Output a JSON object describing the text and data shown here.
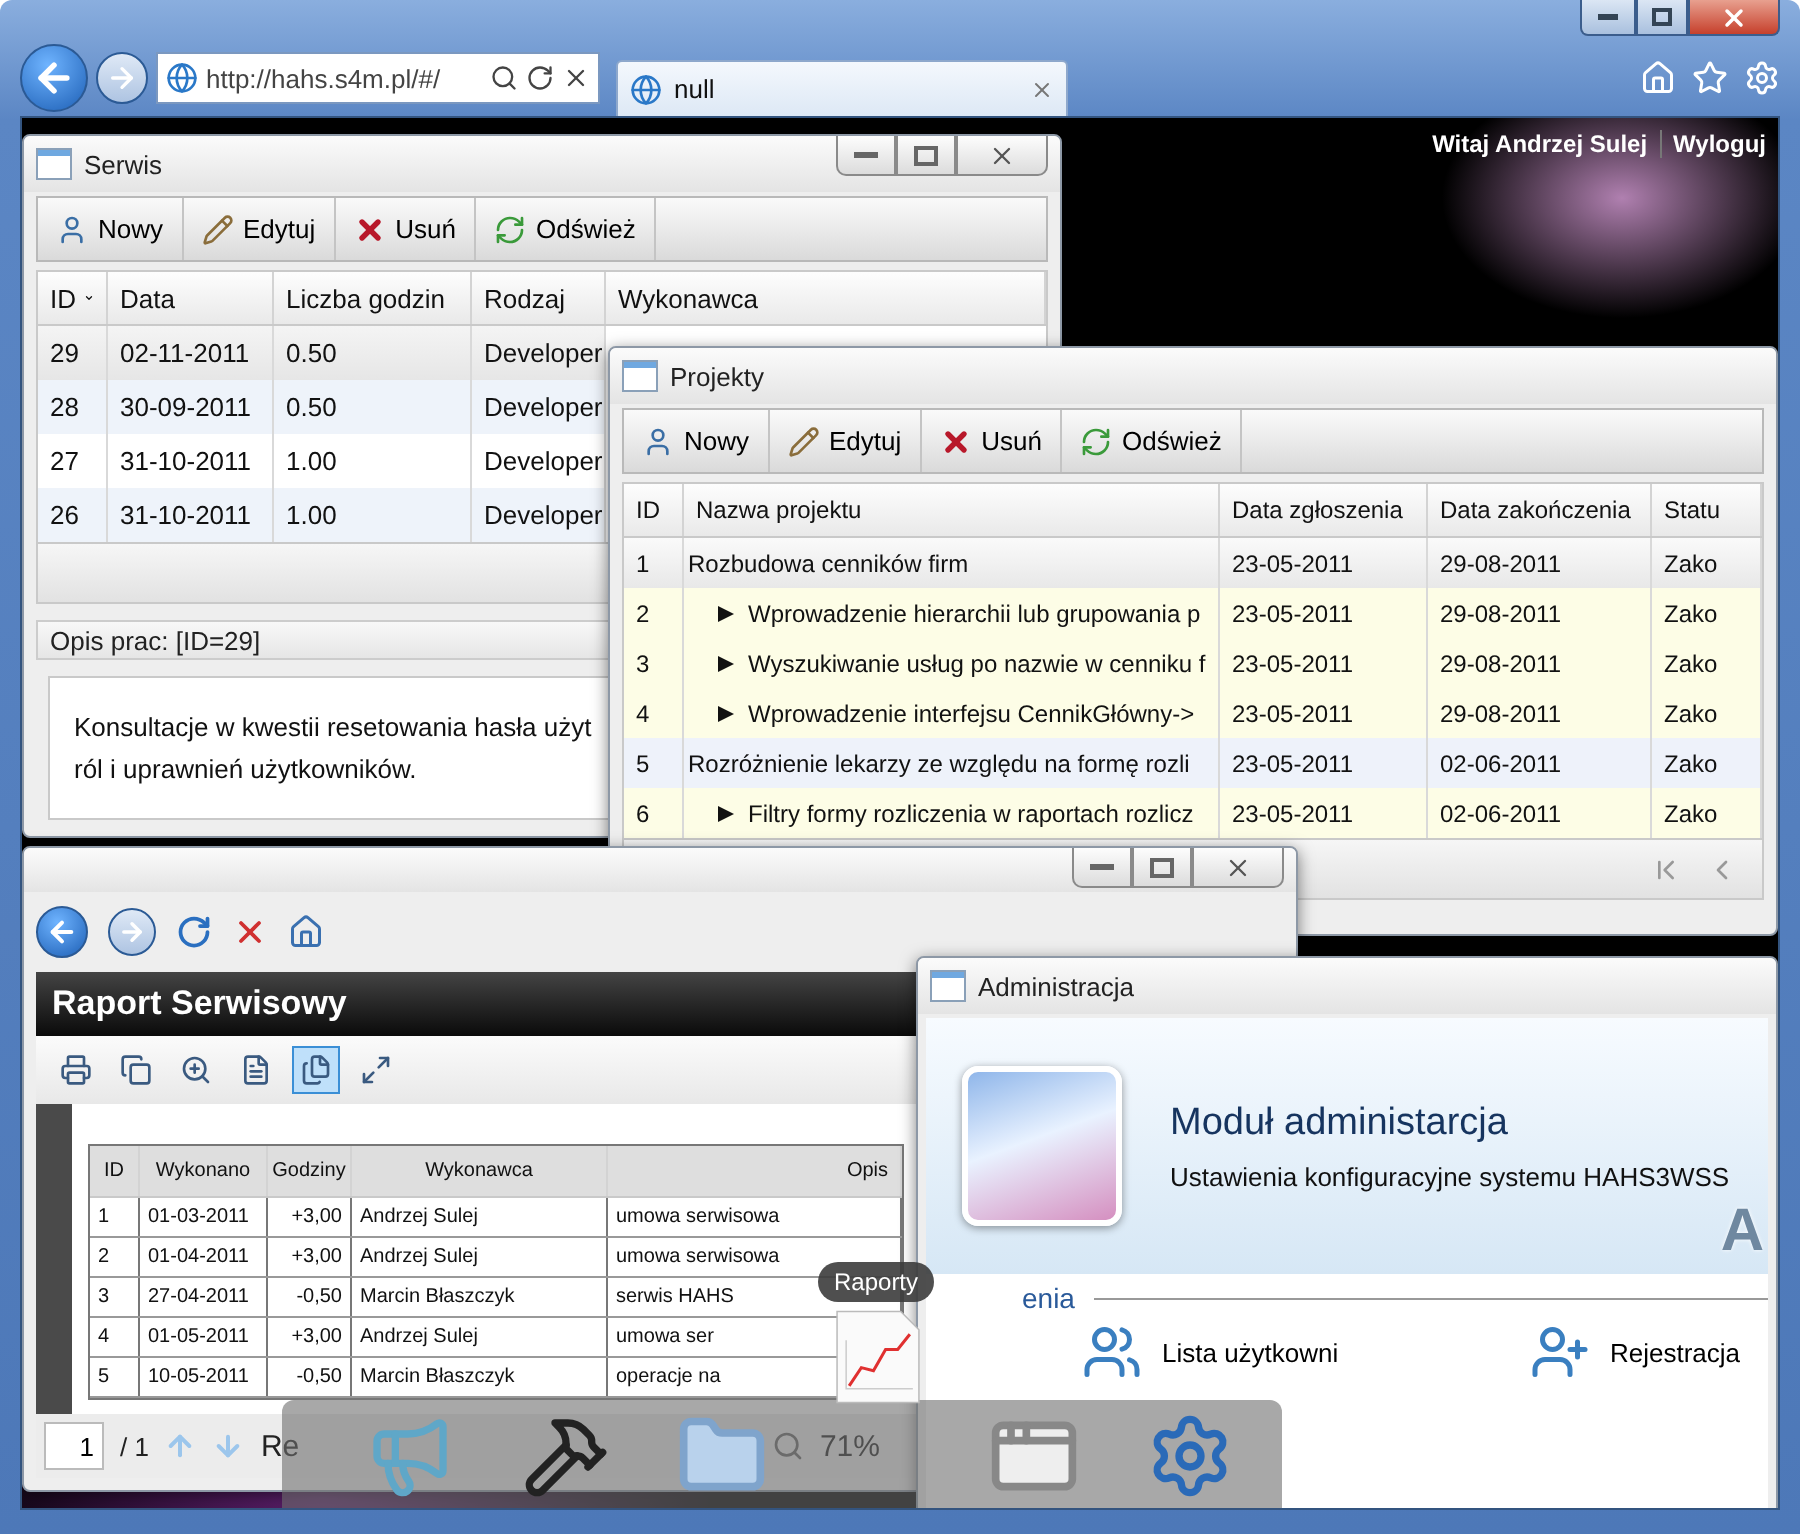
{
  "browser": {
    "address": "http://hahs.s4m.pl/#/",
    "tabs": [
      {
        "label": "null",
        "selected": true
      }
    ]
  },
  "header": {
    "greeting": "Witaj Andrzej Sulej",
    "logout": "Wyloguj"
  },
  "serwis": {
    "title": "Serwis",
    "has_controls": true,
    "toolbar": [
      {
        "kind": "new",
        "label": "Nowy"
      },
      {
        "kind": "edit",
        "label": "Edytuj"
      },
      {
        "kind": "delete",
        "label": "Usuń"
      },
      {
        "kind": "refresh",
        "label": "Odśwież"
      }
    ],
    "columns": [
      {
        "label": "ID",
        "sorted": true
      },
      {
        "label": "Data",
        "sorted": false
      },
      {
        "label": "Liczba godzin",
        "sorted": false
      },
      {
        "label": "Rodzaj",
        "sorted": false
      },
      {
        "label": "Wykonawca",
        "sorted": false
      }
    ],
    "rows": [
      {
        "cells": [
          "29",
          "02-11-2011",
          "0.50",
          "Developer"
        ],
        "selected": true
      },
      {
        "cells": [
          "28",
          "30-09-2011",
          "0.50",
          "Developer"
        ],
        "selected": false
      },
      {
        "cells": [
          "27",
          "31-10-2011",
          "1.00",
          "Developer"
        ],
        "selected": false
      },
      {
        "cells": [
          "26",
          "31-10-2011",
          "1.00",
          "Developer"
        ],
        "selected": false
      }
    ],
    "description_label": "Opis prac: [ID=29]",
    "description_lines": [
      "Konsultacje w kwestii resetowania hasła użyt",
      "ról i uprawnień użytkowników."
    ]
  },
  "projekty": {
    "title": "Projekty",
    "has_controls": false,
    "toolbar": [
      {
        "kind": "new",
        "label": "Nowy"
      },
      {
        "kind": "edit",
        "label": "Edytuj"
      },
      {
        "kind": "delete",
        "label": "Usuń"
      },
      {
        "kind": "refresh",
        "label": "Odśwież"
      }
    ],
    "columns": [
      "ID",
      "Nazwa projektu",
      "Data zgłoszenia",
      "Data zakończenia",
      "Statu"
    ],
    "rows": [
      {
        "id": "1",
        "name": "Rozbudowa cenników firm",
        "reported": "23-05-2011",
        "finished": "29-08-2011",
        "status": "Zako",
        "selected": true,
        "expanded": true,
        "children": [
          {
            "id": "2",
            "name": "Wprowadzenie hierarchii lub grupowania p",
            "reported": "23-05-2011",
            "finished": "29-08-2011",
            "status": "Zako",
            "selected": false,
            "expanded": false
          },
          {
            "id": "3",
            "name": "Wyszukiwanie usług po nazwie w cenniku f",
            "reported": "23-05-2011",
            "finished": "29-08-2011",
            "status": "Zako",
            "selected": false,
            "expanded": false
          },
          {
            "id": "4",
            "name": "Wprowadzenie interfejsu CennikGłówny->",
            "reported": "23-05-2011",
            "finished": "29-08-2011",
            "status": "Zako",
            "selected": false,
            "expanded": false
          }
        ]
      },
      {
        "id": "5",
        "name": "Rozróżnienie lekarzy ze względu na formę rozli",
        "reported": "23-05-2011",
        "finished": "02-06-2011",
        "status": "Zako",
        "selected": false,
        "expanded": true,
        "children": [
          {
            "id": "6",
            "name": "Filtry formy rozliczenia w raportach rozlicz",
            "reported": "23-05-2011",
            "finished": "02-06-2011",
            "status": "Zako",
            "selected": false,
            "expanded": false
          }
        ]
      }
    ]
  },
  "raport": {
    "has_controls": true,
    "title": "Raport Serwisowy",
    "tools": [
      {
        "kind": "print",
        "selected": false
      },
      {
        "kind": "copy",
        "selected": false
      },
      {
        "kind": "zoom",
        "selected": false
      },
      {
        "kind": "single",
        "selected": false
      },
      {
        "kind": "multi",
        "selected": true
      },
      {
        "kind": "fullscreen",
        "selected": false
      }
    ],
    "columns": [
      "ID",
      "Wykonano",
      "Godziny",
      "Wykonawca",
      "Opis"
    ],
    "rows": [
      [
        "1",
        "01-03-2011",
        "+3,00",
        "Andrzej Sulej",
        "umowa serwisowa"
      ],
      [
        "2",
        "01-04-2011",
        "+3,00",
        "Andrzej Sulej",
        "umowa serwisowa"
      ],
      [
        "3",
        "27-04-2011",
        "-0,50",
        "Marcin Błaszczyk",
        "serwis HAHS"
      ],
      [
        "4",
        "01-05-2011",
        "+3,00",
        "Andrzej Sulej",
        "umowa ser"
      ],
      [
        "5",
        "10-05-2011",
        "-0,50",
        "Marcin Błaszczyk",
        "operacje na"
      ]
    ],
    "page": "1",
    "page_total": "/ 1",
    "status_text": "Re",
    "zoom": "71%"
  },
  "admin": {
    "title": "Administracja",
    "heading": "Moduł administarcja",
    "subtitle": "Ustawienia konfiguracyjne systemu HAHS3WSS",
    "banner_letter": "A",
    "section": "enia",
    "items": [
      {
        "kind": "users",
        "label": "Lista użytkowni"
      },
      {
        "kind": "register",
        "label": "Rejestracja"
      }
    ]
  },
  "dock": {
    "tooltip": "Raporty",
    "items": [
      {
        "kind": "megaphone",
        "selected": false
      },
      {
        "kind": "hammer",
        "selected": false
      },
      {
        "kind": "folder",
        "selected": false
      },
      {
        "kind": "report",
        "selected": true
      },
      {
        "kind": "window",
        "selected": false
      },
      {
        "kind": "gear",
        "selected": false
      }
    ]
  }
}
